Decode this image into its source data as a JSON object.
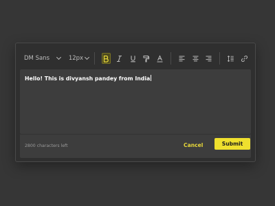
{
  "toolbar": {
    "font_family": "DM Sans",
    "font_size": "12px",
    "buttons": [
      {
        "name": "bold",
        "icon": "bold-icon",
        "active": true
      },
      {
        "name": "italic",
        "icon": "italic-icon",
        "active": false
      },
      {
        "name": "underline",
        "icon": "underline-icon",
        "active": false
      },
      {
        "name": "highlight",
        "icon": "paint-roller-icon",
        "active": false
      },
      {
        "name": "text-color",
        "icon": "text-color-icon",
        "active": false
      },
      {
        "name": "align-left",
        "icon": "align-left-icon",
        "active": false
      },
      {
        "name": "align-center",
        "icon": "align-center-icon",
        "active": false
      },
      {
        "name": "align-right",
        "icon": "align-right-icon",
        "active": false
      },
      {
        "name": "line-spacing",
        "icon": "line-spacing-icon",
        "active": false
      },
      {
        "name": "link",
        "icon": "link-icon",
        "active": false
      }
    ]
  },
  "editor": {
    "text": "Hello! This is divyansh pandey from India"
  },
  "footer": {
    "char_count": "2800 characters left",
    "cancel_label": "Cancel",
    "submit_label": "Submit"
  },
  "colors": {
    "accent": "#efe02e",
    "background": "#363636",
    "card": "#2f2f2f",
    "editor_bg": "#3d3d3d"
  }
}
